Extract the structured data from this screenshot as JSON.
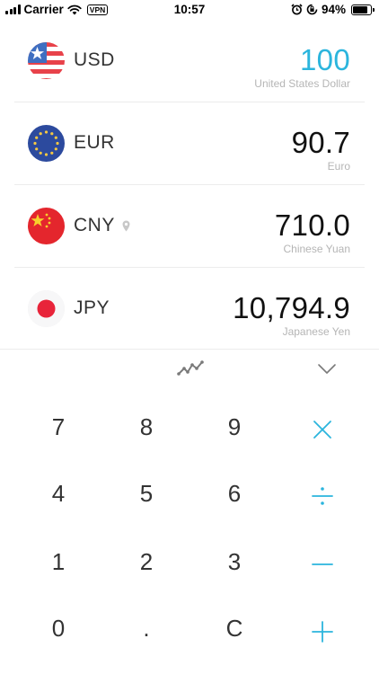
{
  "status_bar": {
    "carrier": "Carrier",
    "vpn": "VPN",
    "time": "10:57",
    "battery": "94%",
    "battery_level": 0.94
  },
  "currencies": [
    {
      "code": "USD",
      "amount": "100",
      "name": "United States Dollar",
      "active": true,
      "flag": "usa-flag-icon"
    },
    {
      "code": "EUR",
      "amount": "90.7",
      "name": "Euro",
      "active": false,
      "flag": "eu-flag-icon"
    },
    {
      "code": "CNY",
      "amount": "710.0",
      "name": "Chinese Yuan",
      "active": false,
      "flag": "china-flag-icon",
      "location_marker": true
    },
    {
      "code": "JPY",
      "amount": "10,794.9",
      "name": "Japanese Yen",
      "active": false,
      "flag": "japan-flag-icon"
    }
  ],
  "toolbar": {
    "chart_icon": "trend-chart-icon",
    "collapse_icon": "chevron-down-icon"
  },
  "keypad": {
    "keys": [
      [
        "7",
        "8",
        "9",
        "×"
      ],
      [
        "4",
        "5",
        "6",
        "÷"
      ],
      [
        "1",
        "2",
        "3",
        "−"
      ],
      [
        "0",
        ".",
        "C",
        "+"
      ]
    ]
  },
  "colors": {
    "accent": "#2bb5dd",
    "text": "#1a1a1a",
    "subtext": "#b5b5b5",
    "divider": "#ececec"
  }
}
